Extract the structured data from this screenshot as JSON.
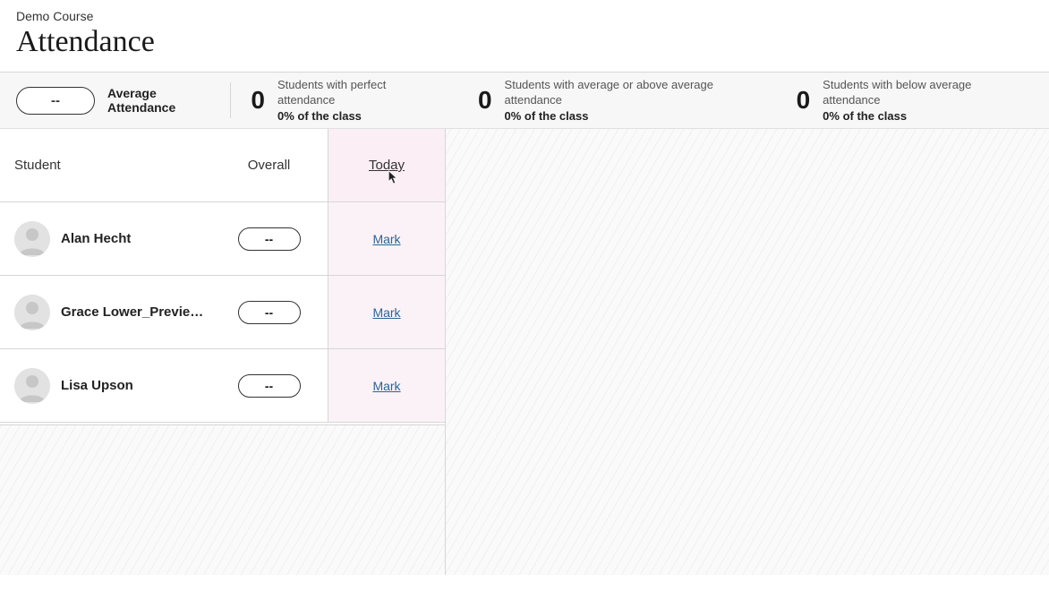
{
  "header": {
    "course_name": "Demo Course",
    "page_title": "Attendance"
  },
  "stats": {
    "average": {
      "value": "--",
      "label": "Average Attendance"
    },
    "perfect": {
      "count": "0",
      "label": "Students with perfect attendance",
      "pct": "0% of the class"
    },
    "avg_or_above": {
      "count": "0",
      "label": "Students with average or above average attendance",
      "pct": "0% of the class"
    },
    "below_avg": {
      "count": "0",
      "label": "Students with below average attendance",
      "pct": "0% of the class"
    }
  },
  "table": {
    "headers": {
      "student": "Student",
      "overall": "Overall",
      "today": "Today"
    },
    "rows": [
      {
        "name": "Alan Hecht",
        "overall": "--",
        "today_action": "Mark"
      },
      {
        "name": "Grace Lower_Preview...",
        "overall": "--",
        "today_action": "Mark"
      },
      {
        "name": "Lisa Upson",
        "overall": "--",
        "today_action": "Mark"
      }
    ]
  }
}
